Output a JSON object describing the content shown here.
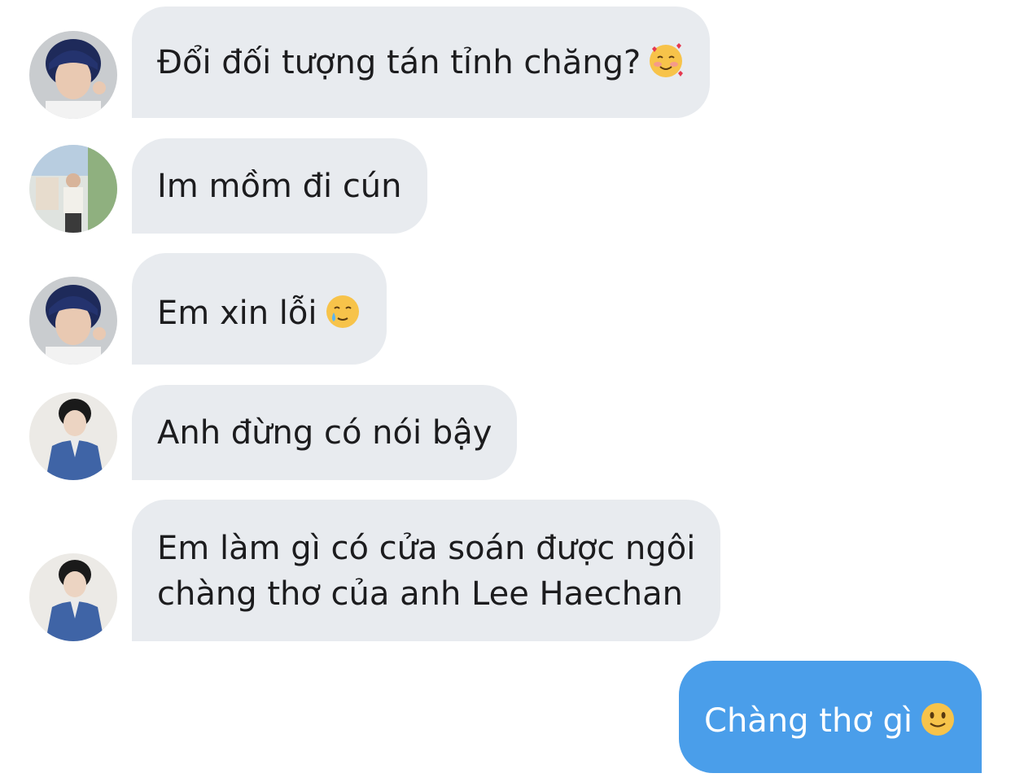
{
  "messages": [
    {
      "sender": "incoming",
      "text": "Đổi đối tượng tán tỉnh chăng?",
      "emoji": "smiling-face-with-hearts-icon"
    },
    {
      "sender": "incoming",
      "text": "Im mồm đi cún",
      "emoji": ""
    },
    {
      "sender": "incoming",
      "text": "Em xin lỗi",
      "emoji": "smiling-face-with-tear-icon"
    },
    {
      "sender": "incoming",
      "text": "Anh đừng có nói bậy",
      "emoji": ""
    },
    {
      "sender": "incoming",
      "lines": [
        "Em làm gì có cửa soán được ngôi",
        "chàng thơ của anh Lee Haechan"
      ],
      "emoji": ""
    },
    {
      "sender": "outgoing",
      "text": "Chàng thơ gì",
      "emoji": "slightly-smiling-face-icon"
    }
  ],
  "colors": {
    "incoming_bubble": "#e8ebef",
    "outgoing_bubble": "#4a9eea",
    "incoming_text": "#1c1c1e",
    "outgoing_text": "#ffffff",
    "background": "#ffffff"
  }
}
